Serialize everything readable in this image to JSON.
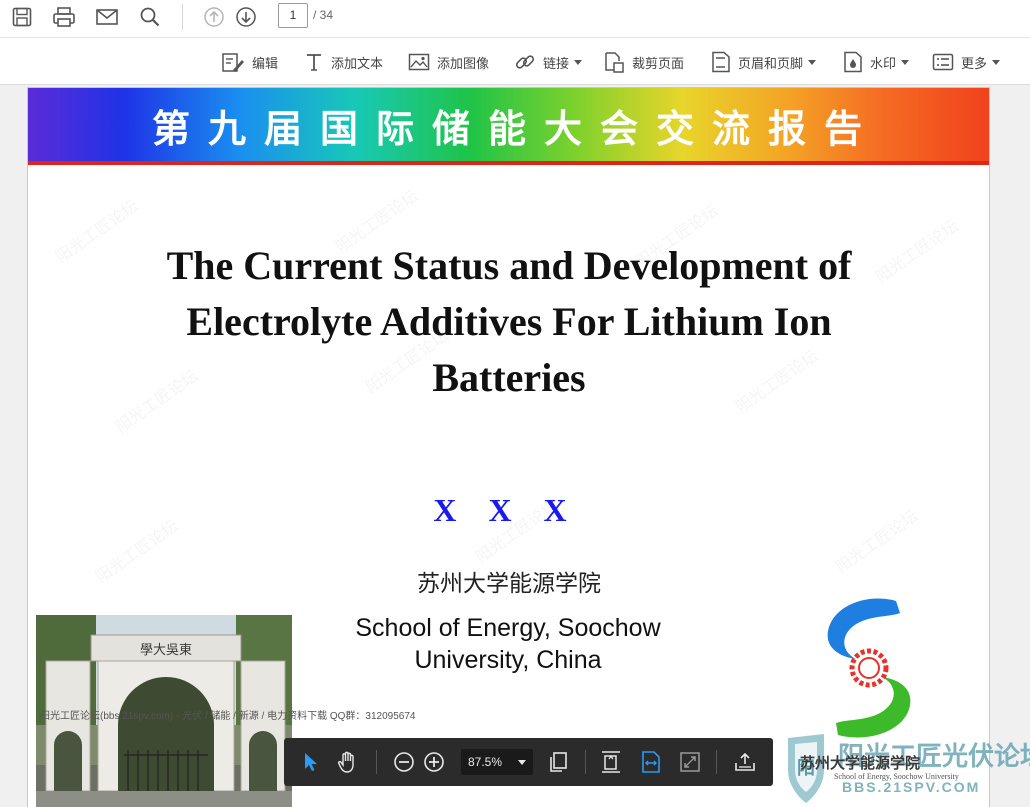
{
  "toolbar": {
    "icons": [
      "save-icon",
      "print-icon",
      "email-icon",
      "search-icon",
      "page-up-icon",
      "page-down-icon"
    ],
    "page_current": "1",
    "page_total": "/ 34"
  },
  "edit_toolbar": {
    "edit": "编辑",
    "add_text": "添加文本",
    "add_image": "添加图像",
    "link": "链接",
    "crop_page": "裁剪页面",
    "header_footer": "页眉和页脚",
    "watermark": "水印",
    "more": "更多"
  },
  "slide": {
    "banner_title": "第九届国际储能大会交流报告",
    "title_line1": "The Current Status and Development of",
    "title_line2": "Electrolyte Additives For Lithium Ion",
    "title_line3": "Batteries",
    "author": [
      "X",
      "X",
      "X"
    ],
    "school_cn": "苏州大学能源学院",
    "school_en_line1": "School of Energy, Soochow",
    "school_en_line2": "University, China",
    "photo_gate_text": "學大吳東",
    "photo_overlay": "阳光工匠论坛(bbs.21spv.com) - 光伏 / 储能 / 新源 / 电力资料下载    QQ群：312095674",
    "logo_text": "苏州大学能源学院",
    "logo_subtext": "School of Energy, Soochow University"
  },
  "watermark_site": {
    "name": "阳光工匠光伏论坛",
    "url": "BBS.21SPV.COM"
  },
  "zoom_toolbar": {
    "zoom": "87.5%"
  },
  "colors": {
    "author_blue": "#1a1af0",
    "banner_underline": "#e2231a",
    "float_bar": "#2b2b2b",
    "active_icon": "#2d9bf0"
  }
}
